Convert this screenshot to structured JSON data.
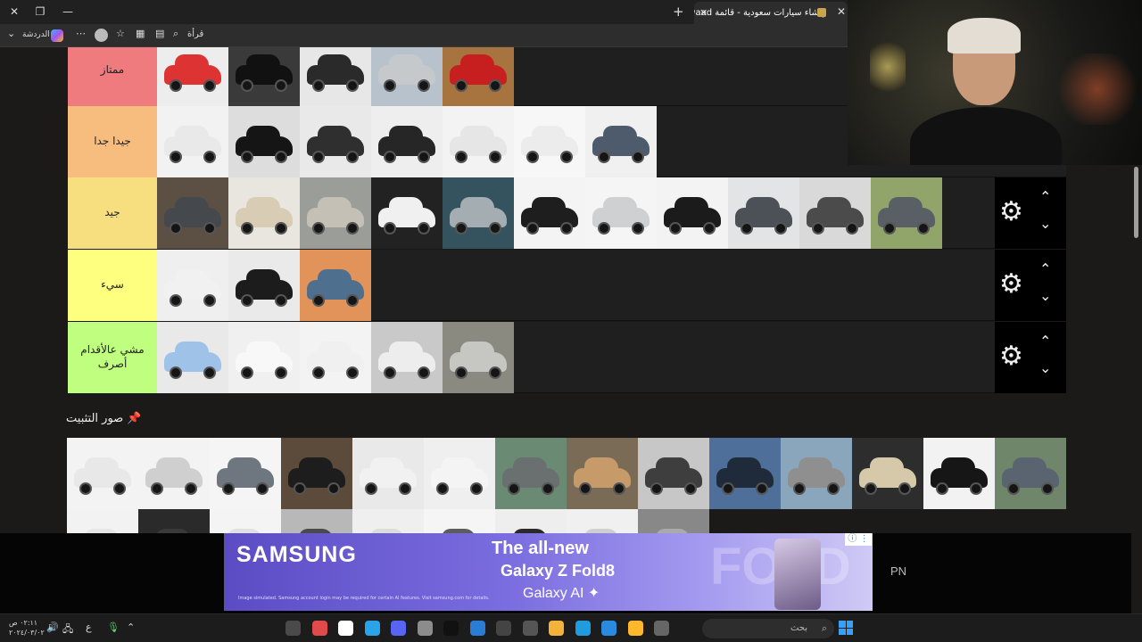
{
  "browser": {
    "tab_title": "إنشاء سيارات سعودية - قائمة Swaad",
    "toolbar": {
      "chat_label": "الدردشة",
      "more_label": "⋯",
      "reader_label": "قرأة"
    }
  },
  "tiers": [
    {
      "label": "ممتاز",
      "color": "#f07b7e",
      "items": [
        {
          "bg": "#ededed",
          "car": "#d33"
        },
        {
          "bg": "#3a3a3a",
          "car": "#111"
        },
        {
          "bg": "#e7e7e7",
          "car": "#2a2a2a"
        },
        {
          "bg": "#b7c2cc",
          "car": "#c5c9cc"
        },
        {
          "bg": "#a7743f",
          "car": "#c71f1f"
        }
      ]
    },
    {
      "label": "جيدا جدا",
      "color": "#f7bd7f",
      "items": [
        {
          "bg": "#f2f2f2",
          "car": "#e9e9e9"
        },
        {
          "bg": "#ddd",
          "car": "#151515"
        },
        {
          "bg": "#e9e9e9",
          "car": "#2f2f2f"
        },
        {
          "bg": "#eee",
          "car": "#262626"
        },
        {
          "bg": "#f3f3f3",
          "car": "#e6e6e6"
        },
        {
          "bg": "#f7f7f7",
          "car": "#ececec"
        },
        {
          "bg": "#f0f0f0",
          "car": "#4d5b6d"
        }
      ]
    },
    {
      "label": "جيد",
      "color": "#f7de7e",
      "items": [
        {
          "bg": "#5c5045",
          "car": "#45494e"
        },
        {
          "bg": "#e9e6e0",
          "car": "#d8ccb4"
        },
        {
          "bg": "#9a9d98",
          "car": "#c4c0b5"
        },
        {
          "bg": "#222",
          "car": "#f0f0f0"
        },
        {
          "bg": "#34535e",
          "car": "#a3adb2"
        },
        {
          "bg": "#f4f4f4",
          "car": "#1e1e1e"
        },
        {
          "bg": "#f5f5f5",
          "car": "#cfd0d2"
        },
        {
          "bg": "#f3f3f3",
          "car": "#1b1b1b"
        },
        {
          "bg": "#e3e4e6",
          "car": "#4b5156"
        },
        {
          "bg": "#d9d9d9",
          "car": "#4b4b4b"
        },
        {
          "bg": "#91a46a",
          "car": "#5a5f66"
        }
      ]
    },
    {
      "label": "سيء",
      "color": "#fefe7f",
      "items": [
        {
          "bg": "#efefef",
          "car": "#f1f1f1"
        },
        {
          "bg": "#eaeaea",
          "car": "#1c1c1c"
        },
        {
          "bg": "#e2935a",
          "car": "#4f6f8f"
        }
      ]
    },
    {
      "label": "مشي عالأقدام أصرف",
      "color": "#c0fe7f",
      "items": [
        {
          "bg": "#e9e9e9",
          "car": "#9fc3e8"
        },
        {
          "bg": "#f0f0f0",
          "car": "#f8f8f8"
        },
        {
          "bg": "#f3f3f3",
          "car": "#f0f0f0"
        },
        {
          "bg": "#c9c9c9",
          "car": "#ededed"
        },
        {
          "bg": "#8a8a80",
          "car": "#c6c6c3"
        }
      ]
    }
  ],
  "pinned": {
    "title": "صور التثبيت",
    "icon": "pin-icon",
    "items": [
      {
        "bg": "#f3f3f3",
        "car": "#e8e8e8"
      },
      {
        "bg": "#f3f3f3",
        "car": "#cfcfcf"
      },
      {
        "bg": "#f5f5f5",
        "car": "#6e7780"
      },
      {
        "bg": "#5c4a3a",
        "car": "#1d1d1d"
      },
      {
        "bg": "#e9e9e9",
        "car": "#f1f1f1"
      },
      {
        "bg": "#efefef",
        "car": "#f4f4f4"
      },
      {
        "bg": "#6b8a74",
        "car": "#6a6f70"
      },
      {
        "bg": "#7a6b57",
        "car": "#c79a6a"
      },
      {
        "bg": "#c7c7c7",
        "car": "#3e3e3e"
      },
      {
        "bg": "#4d6f99",
        "car": "#1f2b3a"
      },
      {
        "bg": "#8aa6bd",
        "car": "#8f8f8f"
      },
      {
        "bg": "#2d2d2d",
        "car": "#d6c9aa"
      },
      {
        "bg": "#f2f2f2",
        "car": "#161616"
      },
      {
        "bg": "#70866a",
        "car": "#5a6470"
      },
      {
        "bg": "#f2f2f2",
        "car": "#e6e6e6"
      },
      {
        "bg": "#2a2a2a",
        "car": "#3a3a3a"
      },
      {
        "bg": "#f4f4f4",
        "car": "#e0e0e0"
      },
      {
        "bg": "#b8b8b8",
        "car": "#4a4a4a"
      },
      {
        "bg": "#efefef",
        "car": "#dcdcdc"
      },
      {
        "bg": "#f5f5f5",
        "car": "#5c5c5c"
      },
      {
        "bg": "#eeeeee",
        "car": "#2a2a2a"
      },
      {
        "bg": "#f0f0f0",
        "car": "#cfcfcf"
      },
      {
        "bg": "#888888",
        "car": "#aaaaaa"
      }
    ]
  },
  "ad": {
    "brand": "SAMSUNG",
    "line1": "The all-new",
    "line2": "Galaxy Z Fold8",
    "line3": "Galaxy AI ✦",
    "fold": "FOLD",
    "fine_print": "Image simulated. Samsung account login may be required for certain AI features. Visit samsung.com for details.",
    "info": "ⓘ ⋮",
    "pn": "PN"
  },
  "taskbar": {
    "time": "٠٢:١١ ص",
    "date": "٢٠٢٤/٠٣/٠٢",
    "lang": "ع",
    "search_placeholder": "بحث",
    "apps": [
      "#4a4a4a",
      "#e04a4a",
      "#fff",
      "#2aa3e8",
      "#5865f2",
      "#8c8c8c",
      "#111",
      "#2b7cd3",
      "#444",
      "#555",
      "#f3b23a",
      "#1f9bde",
      "#2a8ae0",
      "#ffb72b",
      "#666"
    ]
  },
  "window_controls": {
    "close": "✕",
    "max": "❐",
    "min": "—"
  }
}
